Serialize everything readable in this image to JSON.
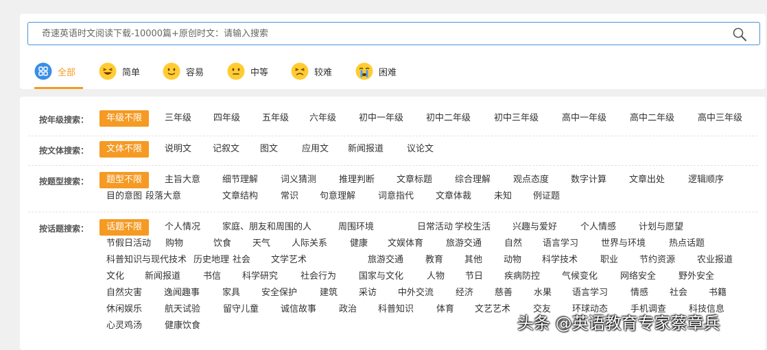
{
  "search": {
    "placeholder": "奇速英语时文阅读下载-10000篇+原创时文：请输入搜索"
  },
  "difficulty_tabs": [
    {
      "label": "全部",
      "icon": "grid-icon",
      "active": true
    },
    {
      "label": "简单",
      "icon": "laughing-face-icon"
    },
    {
      "label": "容易",
      "icon": "smiling-face-icon"
    },
    {
      "label": "中等",
      "icon": "neutral-face-icon"
    },
    {
      "label": "较难",
      "icon": "squinting-face-icon"
    },
    {
      "label": "困难",
      "icon": "crying-face-icon"
    }
  ],
  "colors": {
    "accent": "#f59a23",
    "search_border": "#4a90d9"
  },
  "filters": {
    "grade": {
      "label": "按年级搜索：",
      "selected": "年级不限",
      "lines": [
        [
          "三年级",
          "四年级",
          "五年级",
          "六年级",
          "初中一年级",
          "初中二年级",
          "初中三年级",
          "高中一年级",
          "高中二年级",
          "高中三年级"
        ]
      ]
    },
    "genre": {
      "label": "按文体搜索：",
      "selected": "文体不限",
      "lines": [
        [
          "说明文",
          "记叙文",
          "图文",
          "应用文",
          "新闻报道",
          "议论文"
        ]
      ]
    },
    "question_type": {
      "label": "按题型搜索：",
      "selected": "题型不限",
      "lines": [
        [
          "主旨大意",
          "细节理解",
          "词义猜测",
          "推理判断",
          "文章标题",
          "综合理解",
          "观点态度",
          "数字计算",
          "文章出处",
          "逻辑顺序"
        ],
        [
          "目的意图",
          "段落大意",
          "文章结构",
          "常识",
          "句意理解",
          "词意指代",
          "文章体裁",
          "未知",
          "例证题"
        ]
      ]
    },
    "topic": {
      "label": "按话题搜索：",
      "selected": "话题不限",
      "lines": [
        [
          "个人情况",
          "家庭、朋友和周围的人",
          "周围环境",
          "日常活动",
          "学校生活",
          "兴趣与爱好",
          "个人情感",
          "计划与愿望"
        ],
        [
          "节假日活动",
          "购物",
          "饮食",
          "天气",
          "人际关系",
          "健康",
          "文娱体育",
          "旅游交通",
          "自然",
          "语言学习",
          "世界与环境",
          "热点话题"
        ],
        [
          "科普知识与现代技术",
          "历史地理",
          "社会",
          "文学艺术",
          "旅游交通",
          "教育",
          "其他",
          "动物",
          "科学技术",
          "职业",
          "节约资源",
          "农业报道"
        ],
        [
          "文化",
          "新闻报道",
          "书信",
          "科学研究",
          "社会行为",
          "国家与文化",
          "人物",
          "节日",
          "疾病防控",
          "气候变化",
          "网络安全",
          "野外安全"
        ],
        [
          "自然灾害",
          "逸闻趣事",
          "家具",
          "安全保护",
          "建筑",
          "采访",
          "中外交流",
          "经济",
          "慈善",
          "水果",
          "语言学习",
          "情感",
          "社会",
          "书籍"
        ],
        [
          "休闲娱乐",
          "航天试验",
          "留守儿童",
          "诚信故事",
          "政治",
          "科普知识",
          "体育",
          "文艺艺术",
          "交友",
          "环球动态",
          "手机调查",
          "科技信息"
        ],
        [
          "心灵鸡汤",
          "健康饮食"
        ]
      ]
    }
  },
  "watermark": "头条 @英语教育专家蔡章兵"
}
